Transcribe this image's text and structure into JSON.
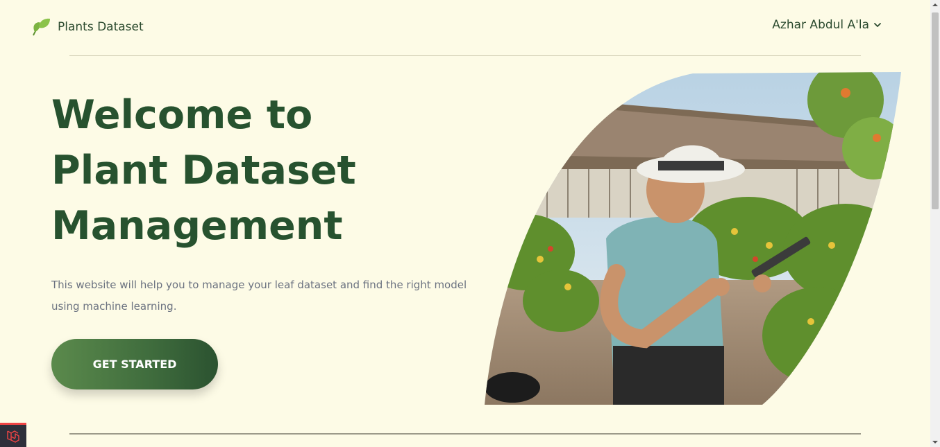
{
  "brand": {
    "name": "Plants Dataset",
    "icon": "leaf-icon",
    "icon_color": "#7cb342"
  },
  "user_menu": {
    "name": "Azhar Abdul A'la",
    "icon": "chevron-down-icon"
  },
  "hero": {
    "title_line1": "Welcome to",
    "title_line2": "Plant Dataset",
    "title_line3": "Management",
    "description": "This website will help you to manage your leaf dataset and find the right model using machine learning.",
    "cta_label": "GET STARTED",
    "image_alt": "farmer-with-tablet-photo"
  },
  "colors": {
    "background": "#fdfbe6",
    "heading": "#27522f",
    "cta_start": "#5b8a4c",
    "cta_end": "#2b5230"
  },
  "debug_badge": {
    "icon": "laravel-icon"
  }
}
